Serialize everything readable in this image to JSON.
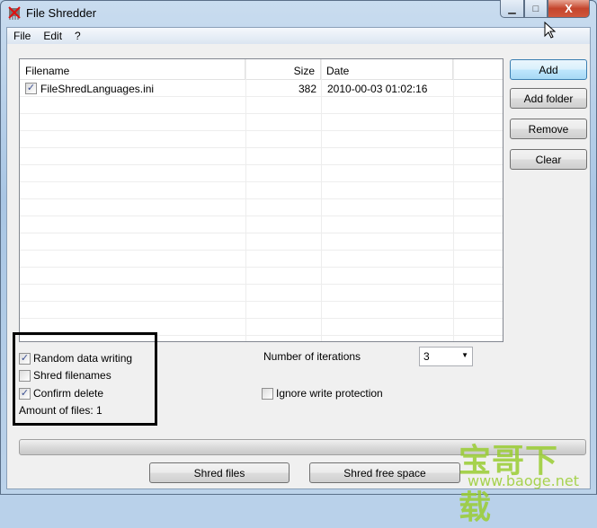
{
  "window": {
    "title": "File Shredder",
    "controls": {
      "minimize": "▁",
      "maximize": "□",
      "close": "X"
    }
  },
  "menu": [
    "File",
    "Edit",
    "?"
  ],
  "list": {
    "columns": [
      "Filename",
      "Size",
      "Date",
      ""
    ],
    "rows": [
      {
        "checked": true,
        "filename": "FileShredLanguages.ini",
        "size": "382",
        "date": "2010-00-03 01:02:16"
      }
    ]
  },
  "buttons": {
    "add": "Add",
    "add_folder": "Add folder",
    "remove": "Remove",
    "clear": "Clear",
    "shred_files": "Shred files",
    "shred_free_space": "Shred free space"
  },
  "options": {
    "random_data_writing": {
      "label": "Random data writing",
      "checked": true
    },
    "shred_filenames": {
      "label": "Shred filenames",
      "checked": false
    },
    "confirm_delete": {
      "label": "Confirm delete",
      "checked": true
    },
    "ignore_write_protection": {
      "label": "Ignore write protection",
      "checked": false
    },
    "amount_of_files": "Amount of files: 1",
    "iterations_label": "Number of iterations",
    "iterations_value": "3"
  },
  "progress": 0,
  "watermark": {
    "title": "宝哥下载",
    "url": "www.baoge.net"
  }
}
